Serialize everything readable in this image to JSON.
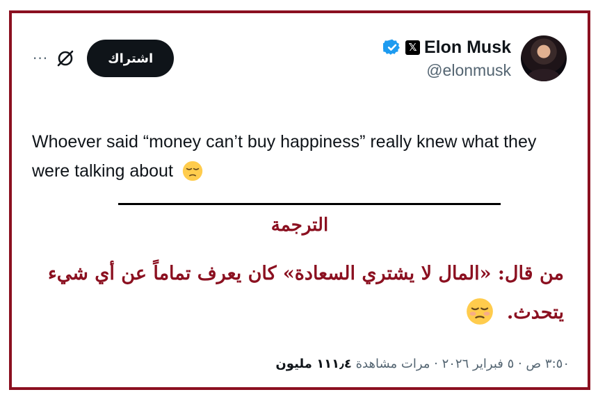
{
  "tweet": {
    "author_name": "Elon Musk",
    "handle": "@elonmusk",
    "x_badge": "𝕏",
    "subscribe_label": "اشتراك",
    "more_label": "···",
    "text": "Whoever said “money can’t buy happiness” really knew what they were talking about",
    "emoji_icon": "pensive-face-emoji"
  },
  "translation": {
    "title": "الترجمة",
    "text": "من قال: «المال لا يشتري السعادة» كان يعرف تماماً عن أي شيء يتحدث."
  },
  "meta": {
    "timestamp": "٣:٥٠ ص · ٥ فبراير ٢٠٢٦ · ",
    "views_count": "١١١٫٤ مليون",
    "views_label": " مرات مشاهدة"
  },
  "colors": {
    "accent": "#8b1020",
    "verified": "#1d9bf0",
    "button": "#0f1419"
  }
}
